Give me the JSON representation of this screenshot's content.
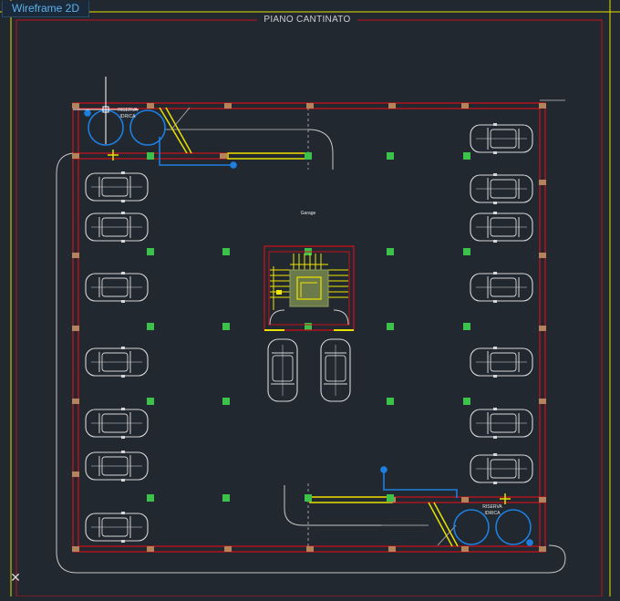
{
  "viewport": {
    "tab_label": "Wireframe 2D",
    "sheet_title": "PIANO CANTINATO",
    "close_icon": "close-icon"
  },
  "labels": {
    "room_label": "Garage",
    "tank_label_top_line1": "RISERVA",
    "tank_label_top_line2": "IDRICA",
    "tank_label_bottom_line1": "RISERVA",
    "tank_label_bottom_line2": "IDRICA"
  },
  "colors": {
    "background": "#212830",
    "wall": "#c8101a",
    "column": "#b5835a",
    "pipe": "#1e7fe0",
    "ramp": "#e8e000",
    "stair": "#f0e600",
    "car": "#d7d7d7",
    "marker": "#3cc24a",
    "frame": "#e8e000"
  }
}
